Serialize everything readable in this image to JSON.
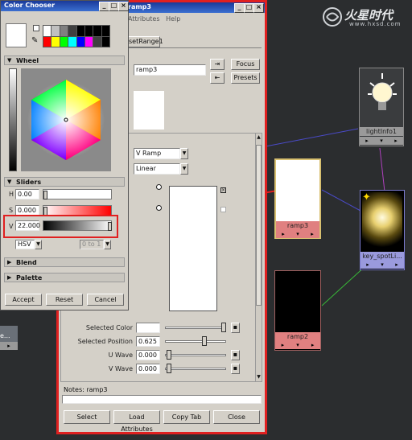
{
  "watermark": {
    "brand": "火星时代",
    "url": "www.hxsd.com"
  },
  "color_chooser": {
    "title": "Color Chooser",
    "sections": {
      "wheel": "Wheel",
      "sliders": "Sliders",
      "blend": "Blend",
      "palette": "Palette"
    },
    "sliders": [
      {
        "label": "H",
        "value": "0.00"
      },
      {
        "label": "S",
        "value": "0.000"
      },
      {
        "label": "V",
        "value": "22.000"
      }
    ],
    "mode": "HSV",
    "range": "0 to 1",
    "buttons": {
      "accept": "Accept",
      "reset": "Reset",
      "cancel": "Cancel"
    },
    "swatch_colors": [
      "#ffffff",
      "#c0c0c0",
      "#808080",
      "#404040",
      "#000000",
      "#000000",
      "#000000",
      "#000000",
      "#ff0000",
      "#ffff00",
      "#00ff00",
      "#00ffff",
      "#0000ff",
      "#ff00ff",
      "#404040",
      "#000000"
    ]
  },
  "attr_editor": {
    "title": "ramp3",
    "menu": "Attributes   Help",
    "tab": "setRange1",
    "node_field": "ramp3",
    "buttons": {
      "focus": "Focus",
      "presets": "Presets"
    },
    "ramp_type": "V Ramp",
    "interpolation": "Linear",
    "attrs": [
      {
        "label": "Selected Color",
        "value": ""
      },
      {
        "label": "Selected Position",
        "value": "0.625"
      },
      {
        "label": "U Wave",
        "value": "0.000"
      },
      {
        "label": "V Wave",
        "value": "0.000"
      }
    ],
    "notes": "Notes: ramp3",
    "bottom_buttons": {
      "select": "Select",
      "load": "Load Attributes",
      "copy": "Copy Tab",
      "close": "Close"
    }
  },
  "nodes": {
    "light_info": "lightInfo1",
    "ramp3": "ramp3",
    "key_spot": "key_spotLi...",
    "ramp2": "ramp2",
    "left_partial": "e..."
  },
  "colors": {
    "highlight": "#e02020",
    "panel": "#d4d0c8",
    "title_blue": "#2750b8"
  }
}
